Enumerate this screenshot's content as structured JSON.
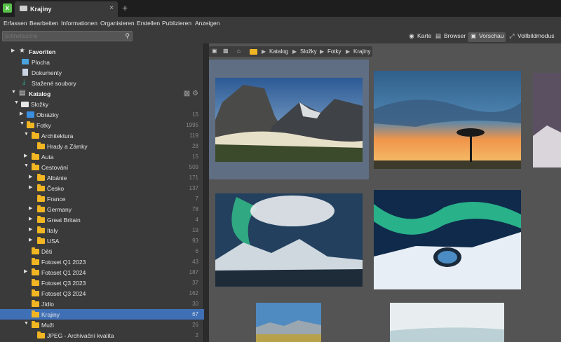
{
  "window": {
    "tab_title": "Krajiny",
    "tab_close": "×",
    "tab_add": "+",
    "app_icon": "x"
  },
  "menu": [
    "Erfassen",
    "Bearbeiten",
    "Informationen",
    "Organisieren",
    "Erstellen",
    "Publizieren",
    "Anzeigen"
  ],
  "search": {
    "placeholder": "Schnellsuche",
    "value": ""
  },
  "modes": [
    {
      "label": "Karte",
      "icon": "map-pin-icon"
    },
    {
      "label": "Browser",
      "icon": "folder-icon"
    },
    {
      "label": "Vorschau",
      "icon": "image-icon",
      "active": true
    },
    {
      "label": "Vollbildmodus",
      "icon": "fullscreen-icon"
    }
  ],
  "sidebar": {
    "favorites": {
      "label": "Favoriten",
      "items": [
        {
          "label": "Plocha"
        },
        {
          "label": "Dokumenty"
        },
        {
          "label": "Stažené soubory"
        }
      ]
    },
    "catalog": {
      "label": "Katalog"
    },
    "tree": [
      {
        "label": "Složky",
        "count": "",
        "level": 1,
        "arrow": "▼"
      },
      {
        "label": "Obrázky",
        "count": "15",
        "level": 2,
        "arrow": "▶"
      },
      {
        "label": "Fotky",
        "count": "1995",
        "level": 2,
        "arrow": "▼"
      },
      {
        "label": "Architektura",
        "count": "119",
        "level": 3,
        "arrow": "▼"
      },
      {
        "label": "Hrady a Zámky",
        "count": "28",
        "level": 4,
        "arrow": ""
      },
      {
        "label": "Auta",
        "count": "15",
        "level": 3,
        "arrow": "▶"
      },
      {
        "label": "Cestování",
        "count": "509",
        "level": 3,
        "arrow": "▼"
      },
      {
        "label": "Albánie",
        "count": "171",
        "level": 4,
        "arrow": "▶"
      },
      {
        "label": "Česko",
        "count": "137",
        "level": 4,
        "arrow": "▶"
      },
      {
        "label": "France",
        "count": "7",
        "level": 4,
        "arrow": ""
      },
      {
        "label": "Germany",
        "count": "78",
        "level": 4,
        "arrow": "▶"
      },
      {
        "label": "Great Britain",
        "count": "4",
        "level": 4,
        "arrow": "▶"
      },
      {
        "label": "Italy",
        "count": "19",
        "level": 4,
        "arrow": "▶"
      },
      {
        "label": "USA",
        "count": "93",
        "level": 4,
        "arrow": "▶"
      },
      {
        "label": "Děti",
        "count": "6",
        "level": 3,
        "arrow": ""
      },
      {
        "label": "Fotoset Q1 2023",
        "count": "43",
        "level": 3,
        "arrow": ""
      },
      {
        "label": "Fotoset Q1 2024",
        "count": "187",
        "level": 3,
        "arrow": "▶"
      },
      {
        "label": "Fotoset Q3 2023",
        "count": "37",
        "level": 3,
        "arrow": ""
      },
      {
        "label": "Fotoset Q3 2024",
        "count": "162",
        "level": 3,
        "arrow": ""
      },
      {
        "label": "Jídlo",
        "count": "30",
        "level": 3,
        "arrow": ""
      },
      {
        "label": "Krajiny",
        "count": "67",
        "level": 3,
        "arrow": "",
        "selected": true
      },
      {
        "label": "Muži",
        "count": "26",
        "level": 3,
        "arrow": "▼"
      },
      {
        "label": "JPEG - Archivační kvalita",
        "count": "2",
        "level": 4,
        "arrow": ""
      }
    ]
  },
  "breadcrumb": [
    "Katalog",
    "Složky",
    "Fotky",
    "Krajiny"
  ],
  "colors": {
    "selection": "#3f6fb5",
    "folder": "#f2b623"
  }
}
